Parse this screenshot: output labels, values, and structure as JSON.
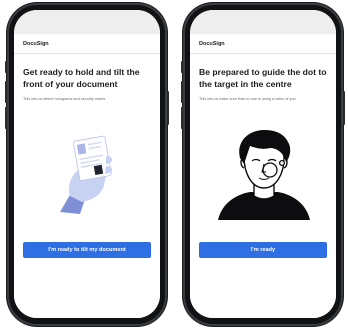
{
  "phones": [
    {
      "brand": "DocuSign",
      "headline": "Get ready to hold and tilt the front of your document",
      "subtext": "This lets us detect holograms and security marks",
      "button_label": "I'm ready to tilt my document",
      "illustration": "hand-holding-id-card-icon"
    },
    {
      "brand": "DocuSign",
      "headline": "Be prepared to guide the dot to the target in the centre",
      "subtext": "This lets us make sure that no one is using a video of you",
      "button_label": "I'm ready",
      "illustration": "face-with-target-dot-icon"
    }
  ],
  "colors": {
    "accent": "#2f6fe4",
    "phone_frame": "#111214",
    "illustration_blue": "#c7d1f2"
  }
}
